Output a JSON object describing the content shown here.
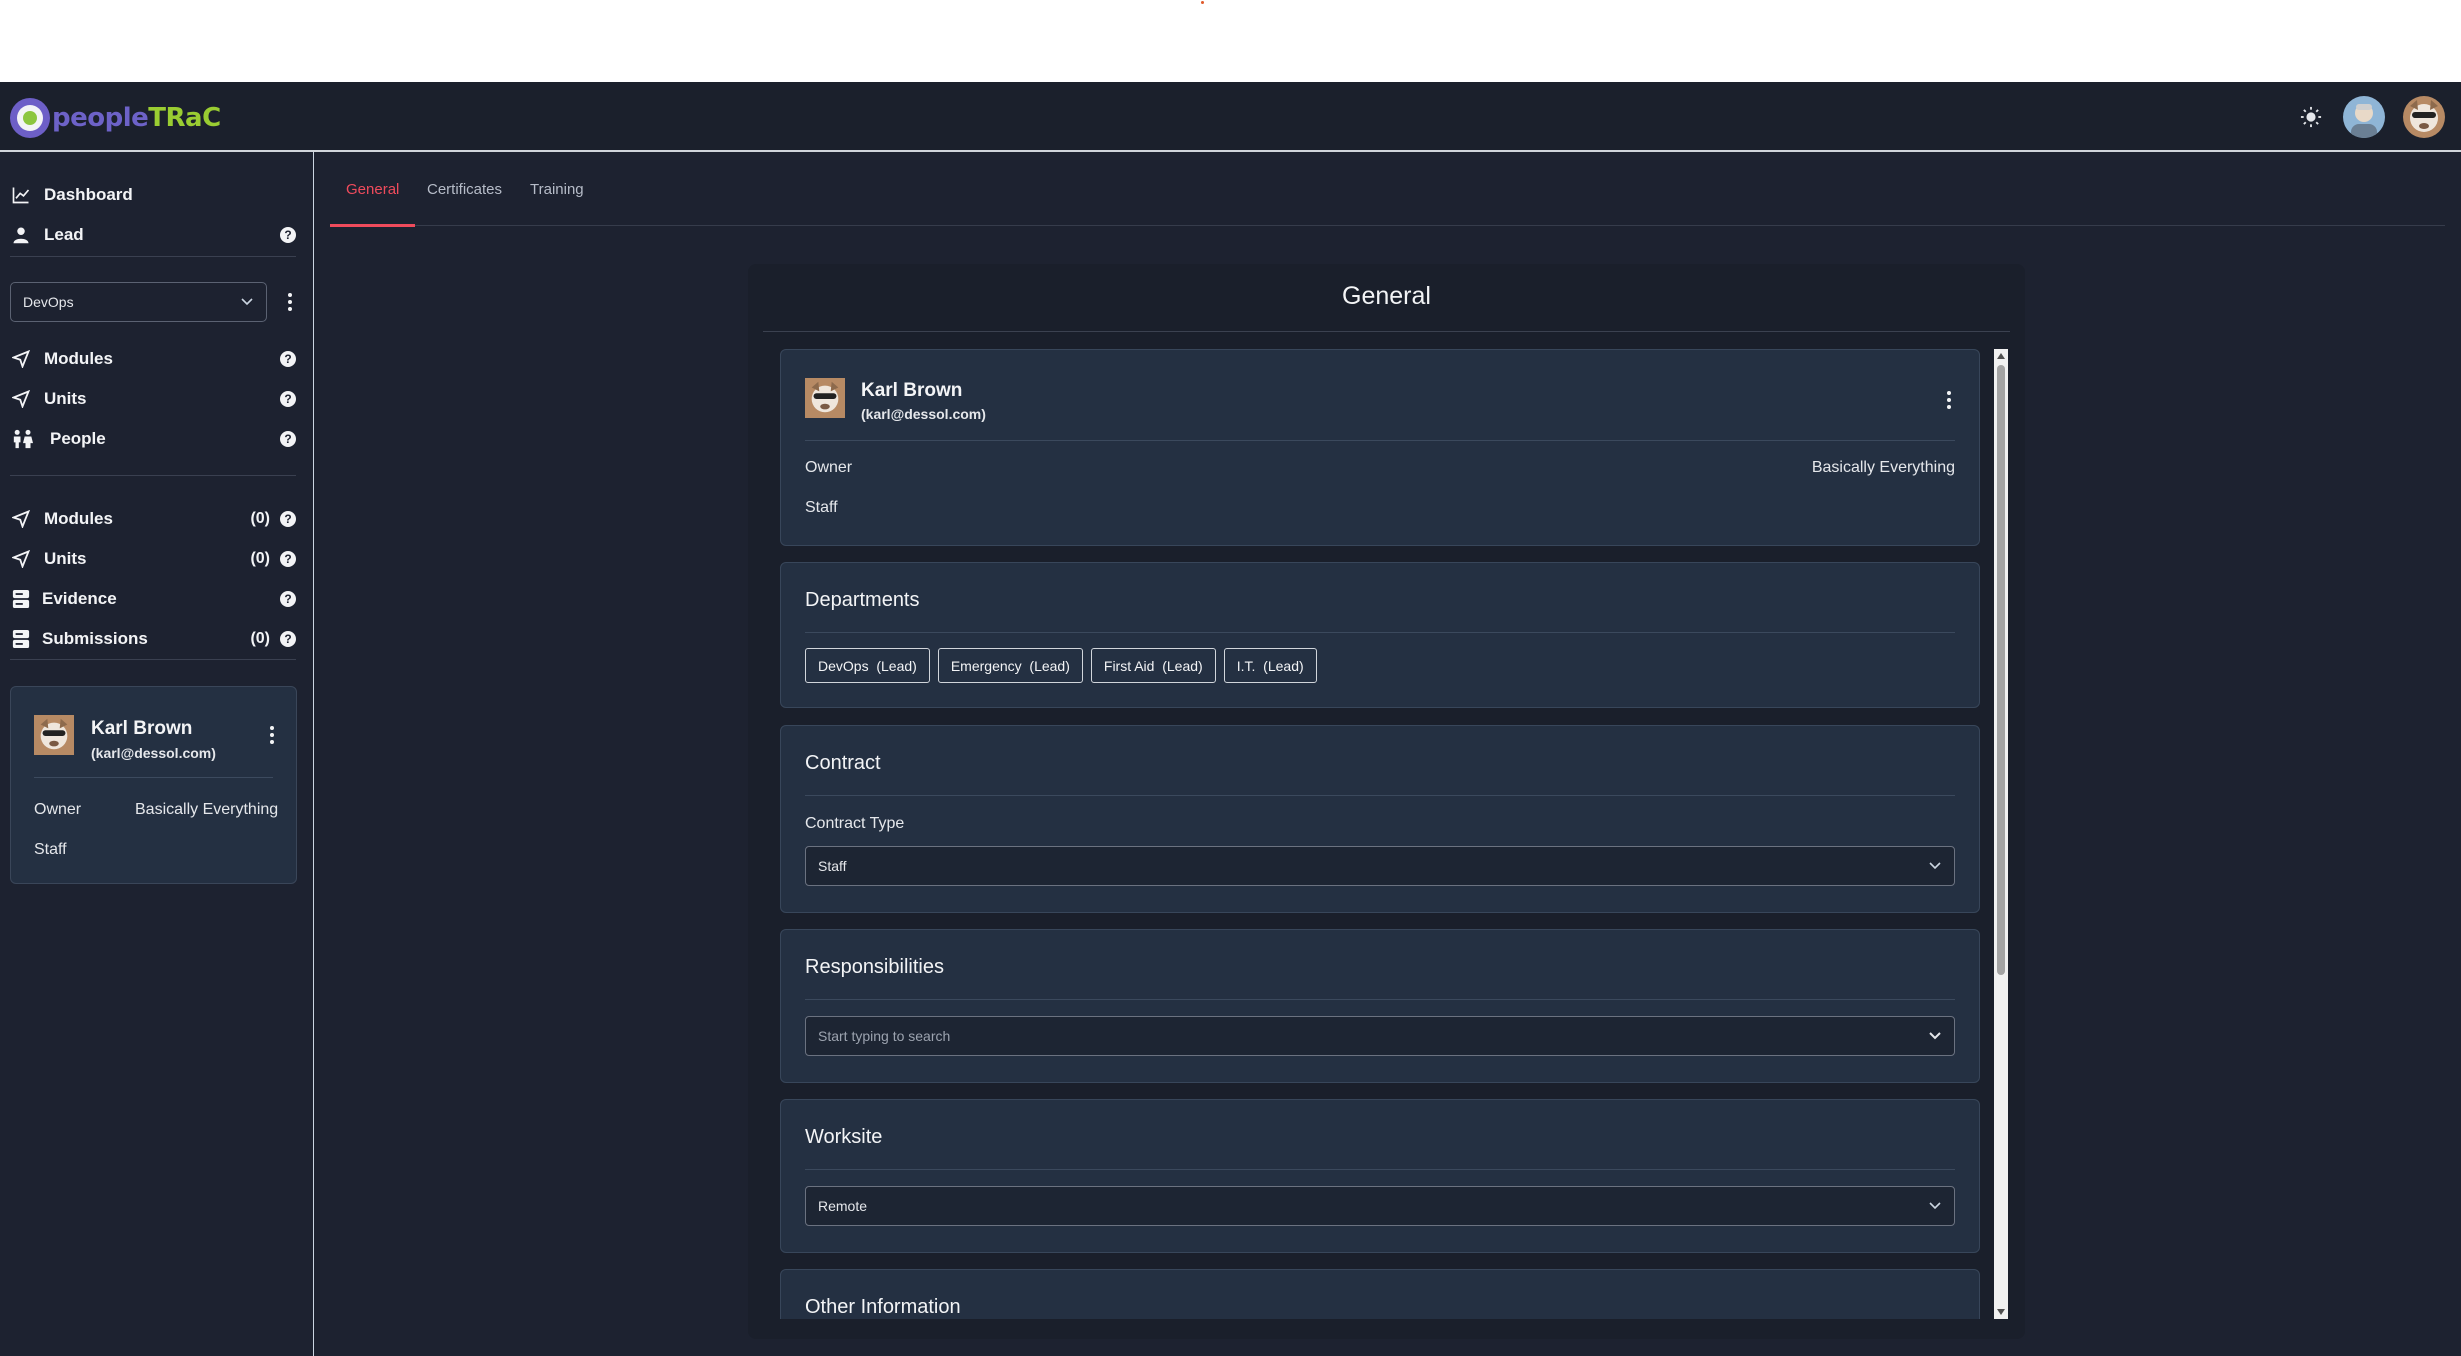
{
  "header": {
    "logo_people": "people",
    "logo_trac": "TRaC",
    "theme_icon": "sun-icon"
  },
  "sidebar": {
    "top_items": [
      {
        "label": "Dashboard",
        "icon": "chart-line-icon"
      },
      {
        "label": "Lead",
        "icon": "user-icon"
      }
    ],
    "department_select": {
      "value": "DevOps"
    },
    "dept_items": [
      {
        "label": "Modules",
        "icon": "send-icon"
      },
      {
        "label": "Units",
        "icon": "send-icon"
      },
      {
        "label": "People",
        "icon": "people-icon"
      }
    ],
    "user_items": [
      {
        "label": "Modules",
        "count": "(0)",
        "icon": "send-icon"
      },
      {
        "label": "Units",
        "count": "(0)",
        "icon": "send-icon"
      },
      {
        "label": "Evidence",
        "count": "",
        "icon": "database-icon"
      },
      {
        "label": "Submissions",
        "count": "(0)",
        "icon": "database-icon"
      }
    ],
    "user_card": {
      "name": "Karl Brown",
      "email": "(karl@dessol.com)",
      "role": "Owner",
      "permission": "Basically Everything",
      "type": "Staff"
    }
  },
  "tabs": [
    {
      "label": "General",
      "active": true
    },
    {
      "label": "Certificates",
      "active": false
    },
    {
      "label": "Training",
      "active": false
    }
  ],
  "panel": {
    "title": "General",
    "user": {
      "name": "Karl Brown",
      "email": "(karl@dessol.com)",
      "role": "Owner",
      "permission": "Basically Everything",
      "type": "Staff"
    },
    "departments": {
      "title": "Departments",
      "chips": [
        "DevOps  (Lead)",
        "Emergency  (Lead)",
        "First Aid  (Lead)",
        "I.T.  (Lead)"
      ]
    },
    "contract": {
      "title": "Contract",
      "label": "Contract Type",
      "value": "Staff"
    },
    "responsibilities": {
      "title": "Responsibilities",
      "placeholder": "Start typing to search"
    },
    "worksite": {
      "title": "Worksite",
      "value": "Remote"
    },
    "other": {
      "title": "Other Information"
    }
  },
  "colors": {
    "accent": "#ef4b5c",
    "background": "#1d2230",
    "card": "#243042",
    "logo_purple": "#6d62c8",
    "logo_green": "#9acd32"
  }
}
